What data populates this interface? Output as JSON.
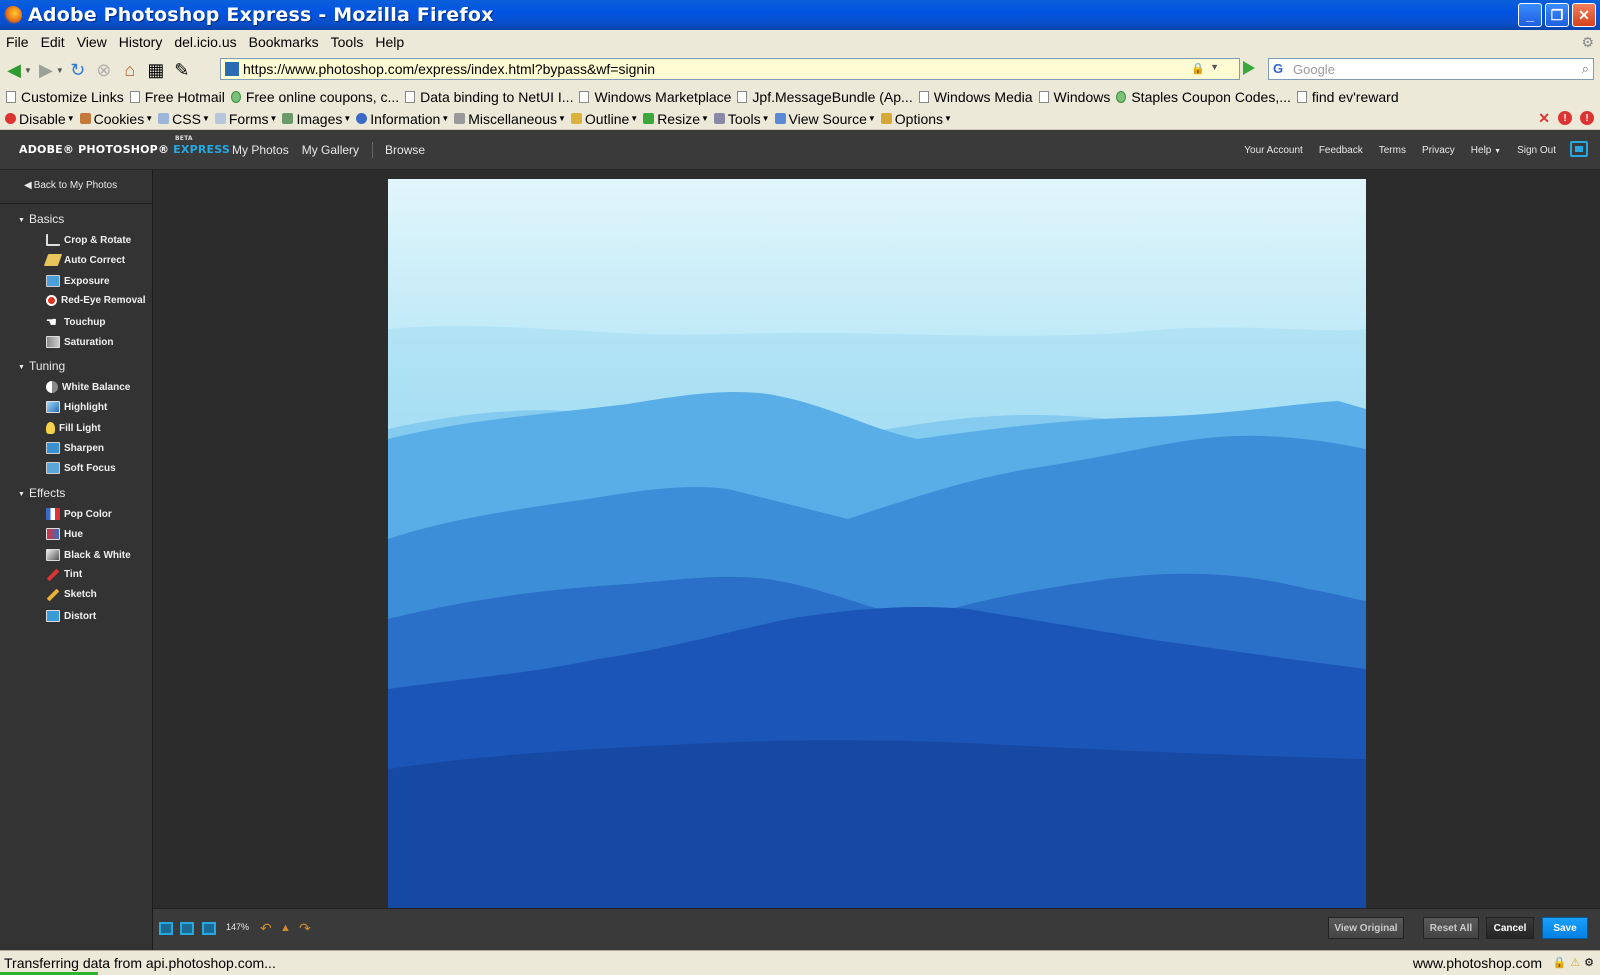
{
  "window": {
    "title": "Adobe Photoshop Express - Mozilla Firefox",
    "min": "_",
    "max": "❐",
    "close": "✕"
  },
  "menu": [
    "File",
    "Edit",
    "View",
    "History",
    "del.icio.us",
    "Bookmarks",
    "Tools",
    "Help"
  ],
  "nav": {
    "url": "https://www.photoshop.com/express/index.html?bypass&wf=signin",
    "search_placeholder": "Google"
  },
  "bookmarks": [
    "Customize Links",
    "Free Hotmail",
    "Free online coupons, c...",
    "Data binding to NetUI I...",
    "Windows Marketplace",
    "Jpf.MessageBundle (Ap...",
    "Windows Media",
    "Windows",
    "Staples Coupon Codes,...",
    "find ev'reward"
  ],
  "devbar": [
    "Disable",
    "Cookies",
    "CSS",
    "Forms",
    "Images",
    "Information",
    "Miscellaneous",
    "Outline",
    "Resize",
    "Tools",
    "View Source",
    "Options"
  ],
  "app": {
    "brand": {
      "name": "ADOBE® PHOTOSHOP®",
      "express": "EXPRESS",
      "beta": "BETA"
    },
    "topnav": [
      "My Photos",
      "My Gallery",
      "Browse"
    ],
    "rightnav": [
      "Your Account",
      "Feedback",
      "Terms",
      "Privacy",
      "Help",
      "Sign Out"
    ],
    "back_link": "Back to My Photos",
    "groups": [
      {
        "name": "Basics",
        "tools": [
          "Crop & Rotate",
          "Auto Correct",
          "Exposure",
          "Red-Eye Removal",
          "Touchup",
          "Saturation"
        ]
      },
      {
        "name": "Tuning",
        "tools": [
          "White Balance",
          "Highlight",
          "Fill Light",
          "Sharpen",
          "Soft Focus"
        ]
      },
      {
        "name": "Effects",
        "tools": [
          "Pop Color",
          "Hue",
          "Black & White",
          "Tint",
          "Sketch",
          "Distort"
        ]
      }
    ],
    "zoom": "147%",
    "actions": {
      "view_original": "View Original",
      "reset_all": "Reset All",
      "cancel": "Cancel",
      "save": "Save"
    }
  },
  "status": {
    "text": "Transferring data from api.photoshop.com...",
    "domain": "www.photoshop.com"
  },
  "colors": {
    "accent": "#25a9e0",
    "save": "#0a8fef"
  }
}
